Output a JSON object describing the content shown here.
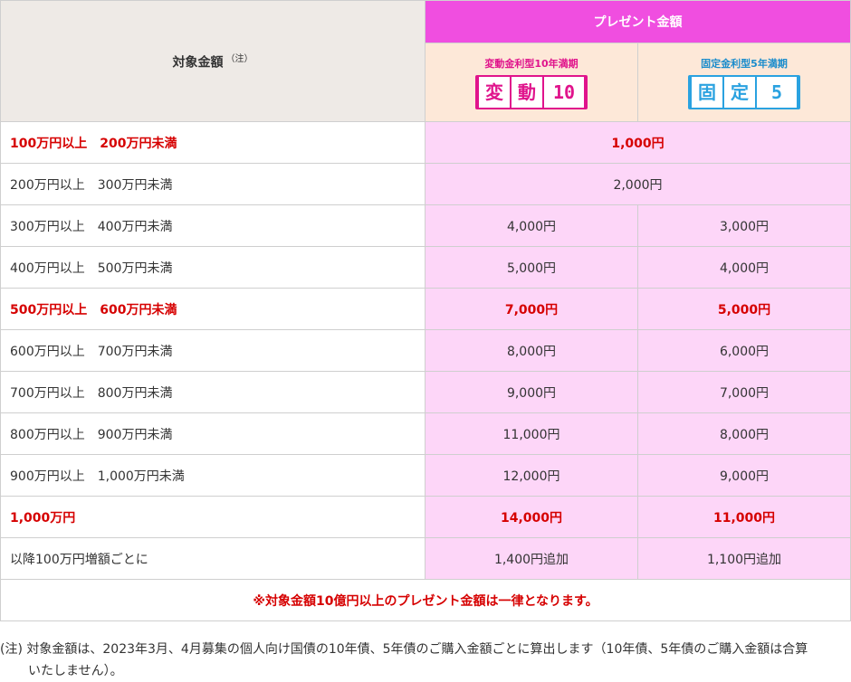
{
  "header": {
    "target_label": "対象金額",
    "target_note": "（注）",
    "present_label": "プレゼント金額",
    "variable": {
      "label": "変動金利型10年満期",
      "badge_chars": [
        "変",
        "動"
      ],
      "badge_num": "10",
      "color": "#e0148c"
    },
    "fixed": {
      "label": "固定金利型5年満期",
      "badge_chars": [
        "固",
        "定"
      ],
      "badge_num": "5",
      "color": "#2aa2e0"
    }
  },
  "rows": [
    {
      "range": "100万円以上　200万円未満",
      "merged": "1,000円"
    },
    {
      "range": "200万円以上　300万円未満",
      "merged": "2,000円"
    },
    {
      "range": "300万円以上　400万円未満",
      "variable": "4,000円",
      "fixed": "3,000円"
    },
    {
      "range": "400万円以上　500万円未満",
      "variable": "5,000円",
      "fixed": "4,000円"
    },
    {
      "range": "500万円以上　600万円未満",
      "variable": "7,000円",
      "fixed": "5,000円"
    },
    {
      "range": "600万円以上　700万円未満",
      "variable": "8,000円",
      "fixed": "6,000円"
    },
    {
      "range": "700万円以上　800万円未満",
      "variable": "9,000円",
      "fixed": "7,000円"
    },
    {
      "range": "800万円以上　900万円未満",
      "variable": "11,000円",
      "fixed": "8,000円"
    },
    {
      "range": "900万円以上　1,000万円未満",
      "variable": "12,000円",
      "fixed": "9,000円"
    },
    {
      "range": "1,000万円",
      "variable": "14,000円",
      "fixed": "11,000円"
    },
    {
      "range": "以降100万円増額ごとに",
      "variable": "1,400円追加",
      "fixed": "1,100円追加"
    }
  ],
  "table_note": "※対象金額10億円以上のプレゼント金額は一律となります。",
  "footnote": {
    "line1": "(注) 対象金額は、2023年3月、4月募集の個人向け国債の10年債、5年債のご購入金額ごとに算出します（10年債、5年債のご購入金額は合算",
    "line2": "いたしません）。"
  },
  "colors": {
    "accent_pink": "#f04ee0",
    "value_bg": "#fdd6f8",
    "highlight_red": "#d60000",
    "header_bg": "#eeeae6",
    "sub_header_bg": "#fde8d8"
  }
}
